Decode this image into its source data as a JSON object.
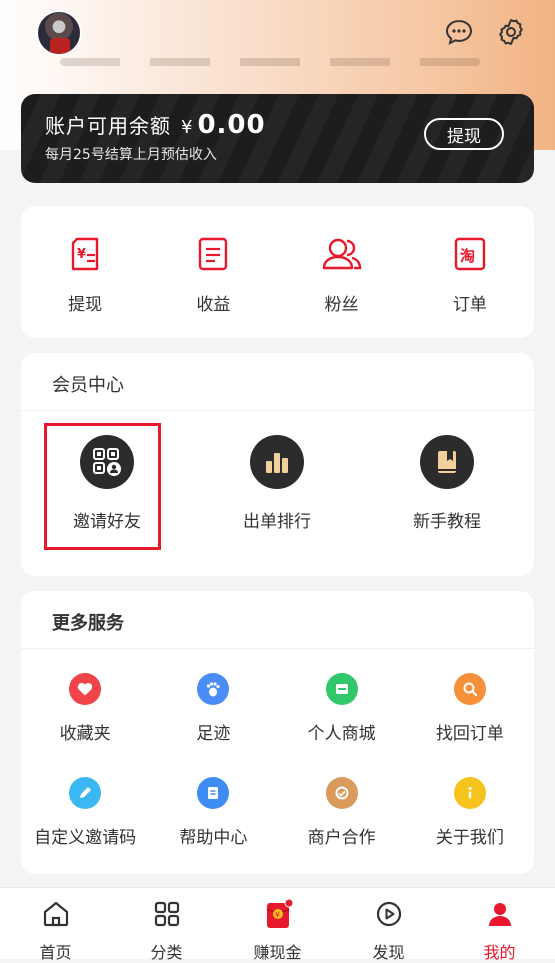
{
  "header": {
    "avatar_icon": "user-avatar",
    "message_icon": "chat-bubble-icon",
    "settings_icon": "gear-icon"
  },
  "balance": {
    "title": "账户可用余额",
    "currency": "¥",
    "amount": "0.00",
    "subtitle": "每月25号结算上月预估收入",
    "withdraw_label": "提现"
  },
  "quick_actions": [
    {
      "label": "提现",
      "icon": "yen-card-icon"
    },
    {
      "label": "收益",
      "icon": "document-icon"
    },
    {
      "label": "粉丝",
      "icon": "users-icon"
    },
    {
      "label": "订单",
      "icon": "taobao-order-icon"
    }
  ],
  "member_center": {
    "title": "会员中心",
    "items": [
      {
        "label": "邀请好友",
        "icon": "qr-invite-icon"
      },
      {
        "label": "出单排行",
        "icon": "bar-chart-icon"
      },
      {
        "label": "新手教程",
        "icon": "book-icon"
      }
    ]
  },
  "more_services": {
    "title": "更多服务",
    "items": [
      {
        "label": "收藏夹",
        "icon": "heart-icon",
        "color": "#f0434a"
      },
      {
        "label": "足迹",
        "icon": "footprint-icon",
        "color": "#4a8df6"
      },
      {
        "label": "个人商城",
        "icon": "shop-icon",
        "color": "#32c76a"
      },
      {
        "label": "找回订单",
        "icon": "search-icon",
        "color": "#f7903a"
      },
      {
        "label": "自定义邀请码",
        "icon": "pencil-icon",
        "color": "#3bb7f2"
      },
      {
        "label": "帮助中心",
        "icon": "help-doc-icon",
        "color": "#3f8cf5"
      },
      {
        "label": "商户合作",
        "icon": "handshake-icon",
        "color": "#d99a5c"
      },
      {
        "label": "关于我们",
        "icon": "info-icon",
        "color": "#f6c21c"
      }
    ]
  },
  "tabbar": {
    "items": [
      {
        "label": "首页",
        "icon": "home-icon"
      },
      {
        "label": "分类",
        "icon": "grid-icon"
      },
      {
        "label": "赚现金",
        "icon": "red-envelope-icon"
      },
      {
        "label": "发现",
        "icon": "play-circle-icon"
      },
      {
        "label": "我的",
        "icon": "person-icon"
      }
    ],
    "active_index": 4,
    "accent_color": "#e8192c"
  }
}
